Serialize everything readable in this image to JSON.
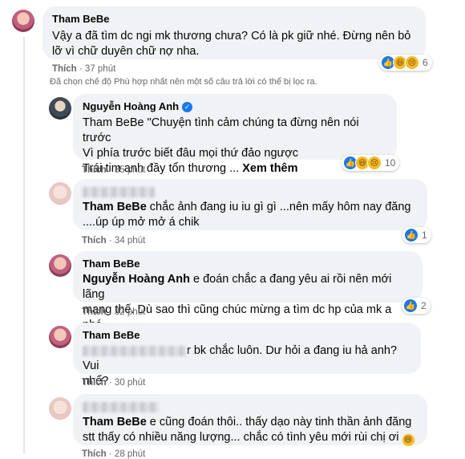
{
  "comments": [
    {
      "author": "Tham BeBe",
      "lines": [
        "Vậy a đã tìm dc ngi mk thương chưa? Có là pk giữ nhé. Đừng nên bỏ",
        "lỡ vì chữ duyên chữ nợ nha."
      ],
      "like": "Thích",
      "time": "37 phút",
      "reaction_count": "6",
      "reactions": [
        "like-icon",
        "haha-icon",
        "sad-icon"
      ]
    },
    {
      "author": "Nguyễn Hoàng Anh",
      "verified": true,
      "lines": [
        "Tham BeBe \"Chuyện tình cảm chúng ta đừng nên nói trước",
        "Vì phía trước biết đâu mọi thứ đảo ngược",
        "Trái tim anh đầy tổn thương ... "
      ],
      "see_more": "Xem thêm",
      "like": "Thích",
      "time": "35 phút",
      "reaction_count": "10",
      "reactions": [
        "like-icon",
        "haha-icon",
        "sad-icon"
      ]
    },
    {
      "mention": "Tham BeBe",
      "line1_rest": " chắc ảnh đang iu iu gì gì ...nên mấy hôm nay đăng",
      "line2": "....úp úp mở mở á chik",
      "like": "Thích",
      "time": "34 phút",
      "reaction_count": "1",
      "reactions": [
        "like-icon"
      ]
    },
    {
      "author": "Tham BeBe",
      "mention": "Nguyễn Hoàng Anh",
      "line1_rest": " e đoán chắc a đang yêu ai rồi nên mới lãng",
      "line2": "mạng thế. Dù sao thì cũng chúc mừng a tìm dc hp của mk a nhé",
      "like": "Thích",
      "time": "32 phút",
      "reaction_count": "2",
      "reactions": [
        "like-icon"
      ]
    },
    {
      "author": "Tham BeBe",
      "line1_rest": "r bk chắc luôn. Dư hỏi a đang iu hả anh? Vui",
      "line2": "nhể?",
      "like": "Thích",
      "time": "30 phút"
    },
    {
      "mention": "Tham BeBe",
      "line1_rest": " e cũng đoán thôi.. thấy dạo này tinh thần ảnh đăng",
      "line2": "stt thấy có nhiều năng lượng... chắc có tình yêu mới rùi chị ơi ",
      "like": "Thích",
      "time": "28 phút"
    }
  ],
  "notice": "Đã chọn chế độ Phù hợp nhất nên một số câu trả lời có thể bị lọc ra.",
  "time_separator": "·"
}
